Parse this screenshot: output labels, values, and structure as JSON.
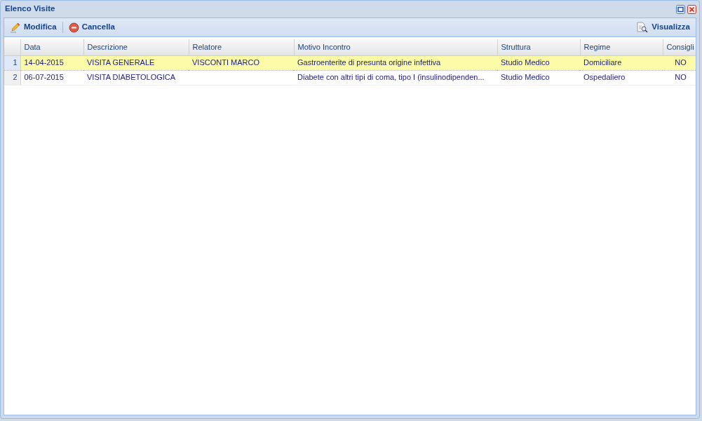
{
  "window": {
    "title": "Elenco Visite"
  },
  "toolbar": {
    "left": [
      {
        "label": "Modifica",
        "kind": "edit"
      },
      {
        "label": "Cancella",
        "kind": "delete"
      }
    ],
    "right": [
      {
        "label": "Visualizza",
        "kind": "view"
      }
    ]
  },
  "table": {
    "columns": [
      "Data",
      "Descrizione",
      "Relatore",
      "Motivo Incontro",
      "Struttura",
      "Regime",
      "Consigli"
    ],
    "rows": [
      {
        "number": "1",
        "selected": true,
        "cells": [
          "14-04-2015",
          "VISITA GENERALE",
          "VISCONTI MARCO",
          "Gastroenterite di presunta origine infettiva",
          "Studio Medico",
          "Domiciliare",
          "NO"
        ]
      },
      {
        "number": "2",
        "selected": false,
        "cells": [
          "06-07-2015",
          "VISITA DIABETOLOGICA",
          "",
          "Diabete con altri tipi di coma, tipo I (insulinodipenden...",
          "Studio Medico",
          "Ospedaliero",
          "NO"
        ]
      }
    ]
  }
}
